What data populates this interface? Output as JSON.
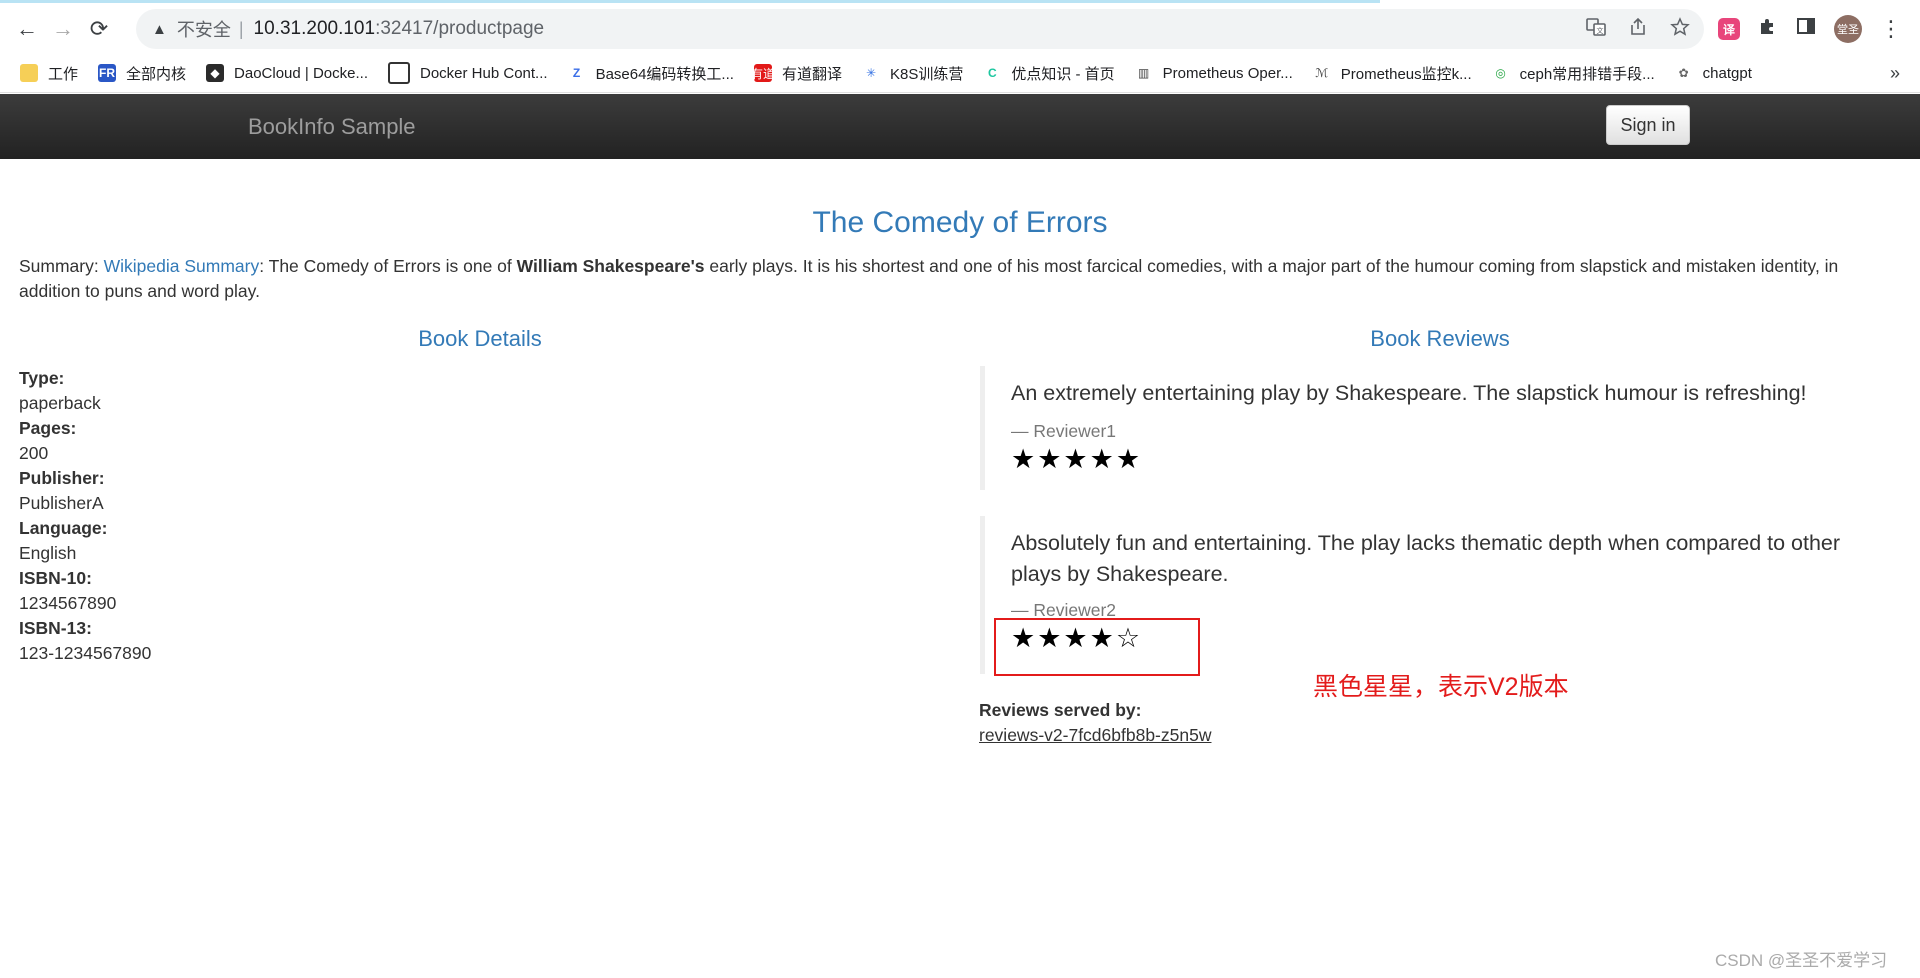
{
  "browser": {
    "nav": {
      "back": "←",
      "forward": "→",
      "reload": "⟳"
    },
    "address": {
      "warning_icon": "▲",
      "security_label": "不安全",
      "separator": "|",
      "host": "10.31.200.101",
      "path": ":32417/productpage"
    },
    "omni_icons": [
      "translate-icon",
      "share-icon",
      "star-icon"
    ],
    "avatar_text": "堂圣",
    "bookmarks": [
      {
        "label": "工作",
        "icon": "folder-icon"
      },
      {
        "label": "全部内核",
        "icon": "fr-icon"
      },
      {
        "label": "DaoCloud | Docke...",
        "icon": "daocloud-icon"
      },
      {
        "label": "Docker Hub Cont...",
        "icon": "docker-icon"
      },
      {
        "label": "Base64编码转换工...",
        "icon": "zj-icon"
      },
      {
        "label": "有道翻译",
        "icon": "youdao-icon"
      },
      {
        "label": "K8S训练营",
        "icon": "k8s-icon"
      },
      {
        "label": "优点知识 - 首页",
        "icon": "youdian-icon"
      },
      {
        "label": "Prometheus Oper...",
        "icon": "book-icon"
      },
      {
        "label": "Prometheus监控k...",
        "icon": "prometheus-icon"
      },
      {
        "label": "ceph常用排错手段...",
        "icon": "ceph-icon"
      },
      {
        "label": "chatgpt",
        "icon": "chatgpt-icon"
      }
    ],
    "bookmarks_more": "»"
  },
  "app": {
    "brand": "BookInfo Sample",
    "signin_label": "Sign in",
    "title": "The Comedy of Errors",
    "summary": {
      "prefix": "Summary: ",
      "link_text": "Wikipedia Summary",
      "text_before_bold": ": The Comedy of Errors is one of ",
      "bold": "William Shakespeare's",
      "text_after_bold": " early plays. It is his shortest and one of his most farcical comedies, with a major part of the humour coming from slapstick and mistaken identity, in addition to puns and word play."
    },
    "details": {
      "title": "Book Details",
      "fields": [
        {
          "label": "Type:",
          "value": "paperback"
        },
        {
          "label": "Pages:",
          "value": "200"
        },
        {
          "label": "Publisher:",
          "value": "PublisherA"
        },
        {
          "label": "Language:",
          "value": "English"
        },
        {
          "label": "ISBN-10:",
          "value": "1234567890"
        },
        {
          "label": "ISBN-13:",
          "value": "123-1234567890"
        }
      ]
    },
    "reviews": {
      "title": "Book Reviews",
      "items": [
        {
          "text": "An extremely entertaining play by Shakespeare. The slapstick humour is refreshing!",
          "reviewer": "— Reviewer1",
          "rating": 5,
          "stars": "★★★★★",
          "star_color": "#000000"
        },
        {
          "text": "Absolutely fun and entertaining. The play lacks thematic depth when compared to other plays by Shakespeare.",
          "reviewer": "— Reviewer2",
          "rating": 4,
          "stars": "★★★★☆",
          "star_color": "#000000"
        }
      ],
      "served_by_label": "Reviews served by:",
      "served_by_value": "reviews-v2-7fcd6bfb8b-z5n5w"
    }
  },
  "annotation": {
    "text": "黑色星星，表示V2版本",
    "color": "#e31b1b"
  },
  "watermark": "CSDN @圣圣不爱学习",
  "colors": {
    "link": "#337ab7",
    "navbar": "#222222",
    "accent_red": "#e31b1b"
  }
}
